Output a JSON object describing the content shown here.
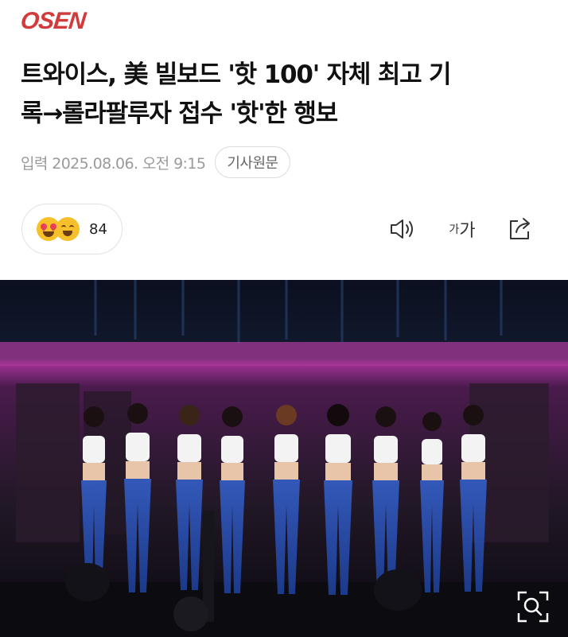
{
  "header": {
    "logo_text": "OSEN",
    "logo_color": "#d23b3b"
  },
  "article": {
    "headline_lines": [
      "트와이스, 美 빌보드 '핫 100' 자체 최고 기",
      "록→롤라팔루자 접수 '핫'한 행보"
    ],
    "published": "입력 2025.08.06. 오전 9:15",
    "source_button": "기사원문"
  },
  "reactions": {
    "emojis": [
      "heart-eyes-emoji",
      "laughing-emoji"
    ],
    "count": "84"
  },
  "toolbar": {
    "speaker_icon": "speaker-icon",
    "font_small": "가",
    "font_big": "가",
    "share_icon": "share-icon"
  },
  "photo": {
    "description_icon": "zoom-icon"
  }
}
